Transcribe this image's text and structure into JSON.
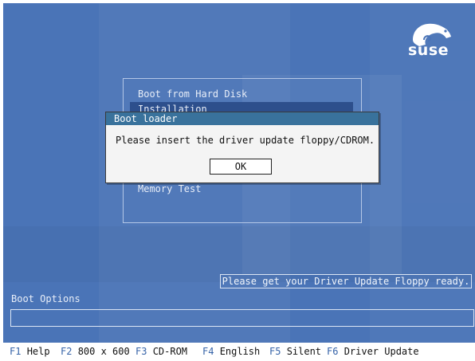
{
  "logo": {
    "text": "suse",
    "icon": "chameleon-icon"
  },
  "boot_menu": {
    "items": [
      {
        "label": "Boot from Hard Disk",
        "selected": false
      },
      {
        "label": "Installation",
        "selected": true
      },
      {
        "label": "Memory Test",
        "selected": false
      }
    ]
  },
  "dialog": {
    "title": "Boot loader",
    "message": "Please insert the driver update floppy/CDROM.",
    "ok_label": "OK"
  },
  "status_message": "Please get your Driver Update Floppy ready.",
  "boot_options": {
    "label": "Boot Options",
    "value": ""
  },
  "fkeys": [
    {
      "key": "F1",
      "label": "Help"
    },
    {
      "key": "F2",
      "label": "800 x 600"
    },
    {
      "key": "F3",
      "label": "CD-ROM"
    },
    {
      "key": "F4",
      "label": "English"
    },
    {
      "key": "F5",
      "label": "Silent"
    },
    {
      "key": "F6",
      "label": "Driver Update"
    }
  ],
  "colors": {
    "background": "#4a74b7",
    "dialog_title": "#39729c",
    "fkey_code": "#3563a8"
  }
}
